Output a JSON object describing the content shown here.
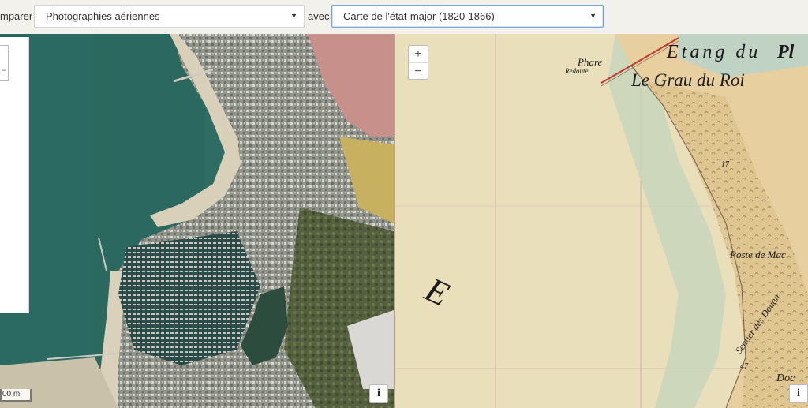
{
  "compare": {
    "label": "mparer",
    "left_layer": "Photographies aériennes",
    "with_label": "avec",
    "right_layer": "Carte de l'état-major (1820-1866)",
    "caret": "▼"
  },
  "zoom": {
    "in": "+",
    "out": "−"
  },
  "info_label": "i",
  "scale_label": "00 m",
  "historic_map": {
    "labels": {
      "phare": "Phare",
      "redoute": "Redoute",
      "etang": "Etang du",
      "etang_end": "Pl",
      "grau": "Le Grau du Roi",
      "poste": "Poste de Mac",
      "sentier": "Sentier des Douan",
      "big_e": "E",
      "num_17": "17",
      "num_47": "47",
      "doc": "Doc"
    }
  },
  "colors": {
    "sea_aerial": "#2e6b63",
    "salt_pink": "#c88f86",
    "old_map_paper": "#eadfb8",
    "old_map_sea": "#c6d5bf"
  }
}
